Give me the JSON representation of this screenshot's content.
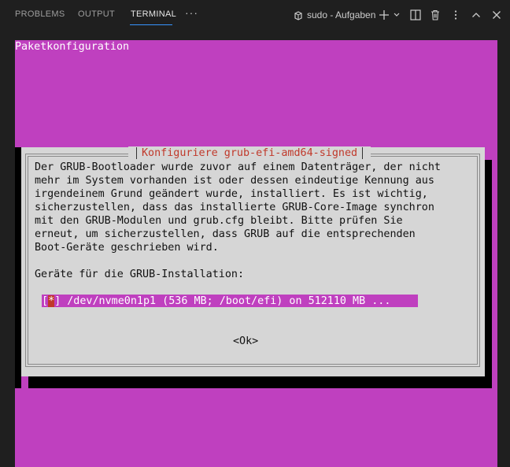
{
  "panel": {
    "tabs": [
      "PROBLEMS",
      "OUTPUT",
      "TERMINAL"
    ],
    "active_tab": "TERMINAL",
    "more_label": "···",
    "terminal_name": "sudo - Aufgaben",
    "accent_color": "#3794ff"
  },
  "terminal": {
    "background": "#bf40bf",
    "heading": "Paketkonfiguration",
    "dialog": {
      "title": "Konfiguriere grub-efi-amd64-signed",
      "body_lines": [
        "Der GRUB-Bootloader wurde zuvor auf einem Datenträger, der nicht",
        "mehr im System vorhanden ist oder dessen eindeutige Kennung aus",
        "irgendeinem Grund geändert wurde, installiert. Es ist wichtig,",
        "sicherzustellen, dass das installierte GRUB-Core-Image synchron",
        "mit den GRUB-Modulen und grub.cfg bleibt. Bitte prüfen Sie",
        "erneut, um sicherzustellen, dass GRUB auf die entsprechenden",
        "Boot-Geräte geschrieben wird."
      ],
      "install_label": "Geräte für die GRUB-Installation:",
      "option": {
        "checked": true,
        "bracket_open": "[",
        "mark": "*",
        "bracket_close": "]",
        "text": " /dev/nvme0n1p1 (536 MB; /boot/efi) on 512110 MB ..."
      },
      "ok_button": "<Ok>"
    }
  }
}
